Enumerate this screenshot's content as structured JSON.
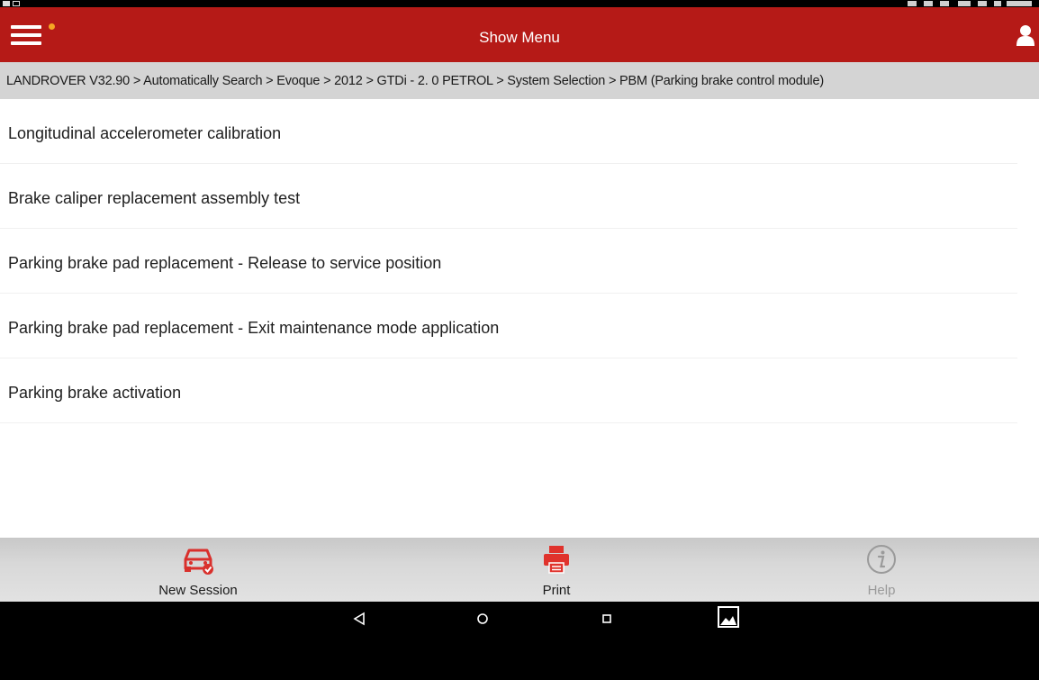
{
  "header": {
    "title": "Show Menu",
    "accent_color": "#b51a17",
    "notification_color": "#f5a623"
  },
  "breadcrumb": {
    "text": "LANDROVER V32.90 > Automatically Search > Evoque > 2012 > GTDi - 2. 0 PETROL > System Selection > PBM (Parking brake control module)"
  },
  "functions": [
    {
      "label": "Longitudinal accelerometer calibration"
    },
    {
      "label": "Brake caliper replacement assembly test"
    },
    {
      "label": "Parking brake pad replacement - Release to service position"
    },
    {
      "label": "Parking brake pad replacement - Exit maintenance mode application"
    },
    {
      "label": "Parking brake activation"
    }
  ],
  "toolbar": {
    "new_session_label": "New Session",
    "new_session_icon": "car-check-icon",
    "print_label": "Print",
    "print_icon": "printer-icon",
    "help_label": "Help",
    "help_icon": "info-icon",
    "help_enabled": false
  },
  "navigation": {
    "back_icon": "back-triangle-icon",
    "home_icon": "home-circle-icon",
    "recents_icon": "recents-square-icon",
    "screenshot_icon": "gallery-icon"
  }
}
